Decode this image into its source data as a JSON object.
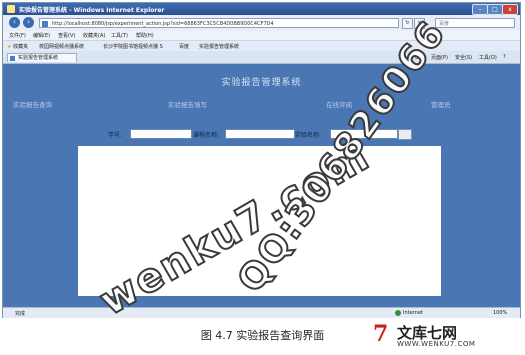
{
  "window": {
    "title": "实验报告管理系统 - Windows Internet Explorer",
    "controls": [
      "–",
      "□",
      "x"
    ]
  },
  "address_bar": {
    "url": "http://localhost:8080/jsp/experiment_action.jsp?sid=68863FC3C5CB4D0BB9D0C4CF7D4",
    "search_placeholder": "百度"
  },
  "menu": [
    "文件(F)",
    "编辑(E)",
    "查看(V)",
    "收藏夹(A)",
    "工具(T)",
    "帮助(H)"
  ],
  "favorites_bar": {
    "label": "收藏夹",
    "items": [
      "校园网视频点播系统",
      "长沙学院图书馆视频点播 S",
      "百度",
      "实验报告管理系统"
    ]
  },
  "tab": {
    "label": "实验报告管理系统"
  },
  "command_bar": [
    "页面(P)",
    "安全(S)",
    "工具(O)"
  ],
  "page": {
    "title": "实验报告管理系统",
    "nav": [
      "实验报告查询",
      "实验报告填写",
      "在线评阅",
      "管理员"
    ],
    "form": {
      "student_no_label": "学号:",
      "course_label": "课程名称:",
      "experiment_label": "实验名称:"
    }
  },
  "status_bar": {
    "left": "完成",
    "zone": "Internet",
    "zoom": "100%"
  },
  "caption": "图 4.7  实验报告查询界面",
  "logo": {
    "mark": "7",
    "name": "文库七网",
    "url": "WWW.WENKU7.COM"
  },
  "watermarks": [
    "wenku7.com",
    "QQ:306826066"
  ]
}
